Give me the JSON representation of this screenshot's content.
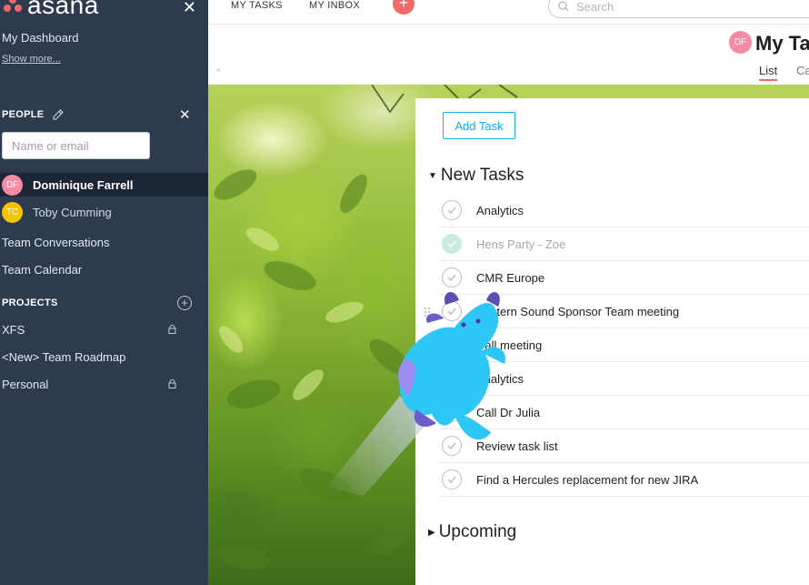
{
  "sidebar": {
    "logo_text": "asana",
    "dashboard_label": "My Dashboard",
    "show_more_label": "Show more...",
    "people_title": "PEOPLE",
    "people_input_placeholder": "Name or email",
    "people": [
      {
        "initials": "DF",
        "name": "Dominique Farrell",
        "color": "#f48aa4",
        "active": true
      },
      {
        "initials": "TC",
        "name": "Toby Cumming",
        "color": "#f5c400",
        "active": false
      }
    ],
    "team_conversations_label": "Team Conversations",
    "team_calendar_label": "Team Calendar",
    "projects_title": "PROJECTS",
    "projects": [
      {
        "name": "XFS",
        "locked": true
      },
      {
        "name": "<New> Team Roadmap",
        "locked": false
      },
      {
        "name": "Personal",
        "locked": true
      }
    ]
  },
  "topbar": {
    "my_tasks_label": "MY TASKS",
    "my_inbox_label": "MY INBOX",
    "search_placeholder": "Search"
  },
  "header": {
    "avatar_initials": "DF",
    "title": "My Ta",
    "tabs": [
      "List",
      "Ca"
    ]
  },
  "panel": {
    "add_task_label": "Add Task",
    "new_tasks_section": "New Tasks",
    "upcoming_section": "Upcoming",
    "tasks": [
      {
        "name": "Analytics",
        "done": false
      },
      {
        "name": "Hens Party - Zoe",
        "done": true
      },
      {
        "name": "CMR Europe",
        "done": false
      },
      {
        "name": "Eastern Sound Sponsor Team meeting",
        "done": false
      },
      {
        "name": "Call meeting",
        "done": false
      },
      {
        "name": "Analytics",
        "done": false
      },
      {
        "name": "Call Dr Julia",
        "done": false
      },
      {
        "name": "Review task list",
        "done": false
      },
      {
        "name": "Find a Hercules replacement for new JIRA",
        "done": false
      }
    ]
  },
  "colors": {
    "sidebar_bg": "#2e3b4f",
    "accent_coral": "#f06a6a",
    "accent_blue": "#14aaf5"
  }
}
